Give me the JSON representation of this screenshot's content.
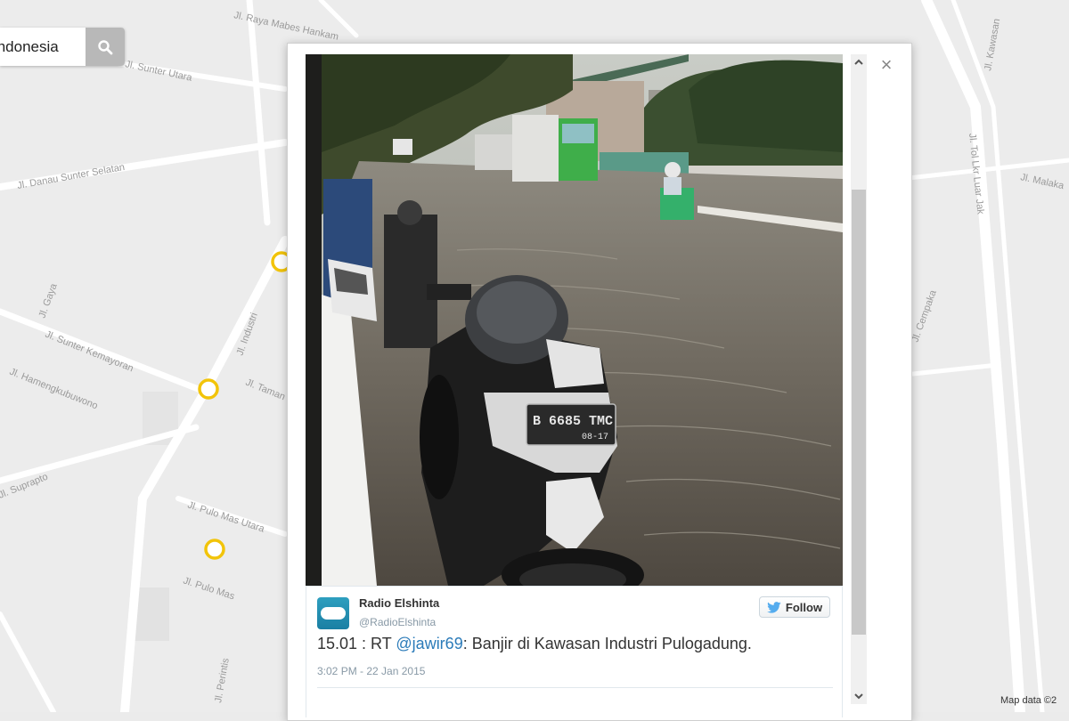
{
  "map": {
    "search": {
      "value": "Indonesia"
    },
    "attribution": "Map data ©2",
    "street_labels": [
      "Jl. Raya Mabes Hankam",
      "Jl. Sunter Utara",
      "Jl. Danau Sunter Selatan",
      "Jl. Gaya",
      "Jl. Sunter Kemayoran",
      "Jl. Hamengkubuwono",
      "Jl. Taman",
      "Jl. Industri",
      "Jl. Pulo Mas Utara",
      "Jl. Pulo Mas",
      "Jl. Suprapto",
      "Jl. Perintis",
      "Jl. Tol Lkr Luar Jak",
      "Jl. Malaka",
      "Jl. Cempaka",
      "Jl. Kawasan"
    ]
  },
  "popup": {
    "close_label": "×",
    "tweet": {
      "author_name": "Radio Elshinta",
      "author_handle": "@RadioElshinta",
      "follow_label": "Follow",
      "text_prefix": "15.01 : RT ",
      "mention": "@jawir69",
      "text_suffix": ": Banjir di Kawasan Industri Pulogadung.",
      "timestamp": "3:02 PM - 22 Jan 2015"
    },
    "photo": {
      "plate_main": "B 6685 TMC",
      "plate_sub": "08-17"
    }
  },
  "colors": {
    "map_bg": "#ebebeb",
    "road": "#ffffff",
    "marker": "#f2c40a",
    "twitter_blue": "#55acee",
    "link": "#2b7bb9"
  },
  "icons": {
    "search": "search-icon",
    "close": "close-icon",
    "twitter": "twitter-bird-icon",
    "scroll_up": "chevron-up-icon",
    "scroll_down": "chevron-down-icon"
  }
}
